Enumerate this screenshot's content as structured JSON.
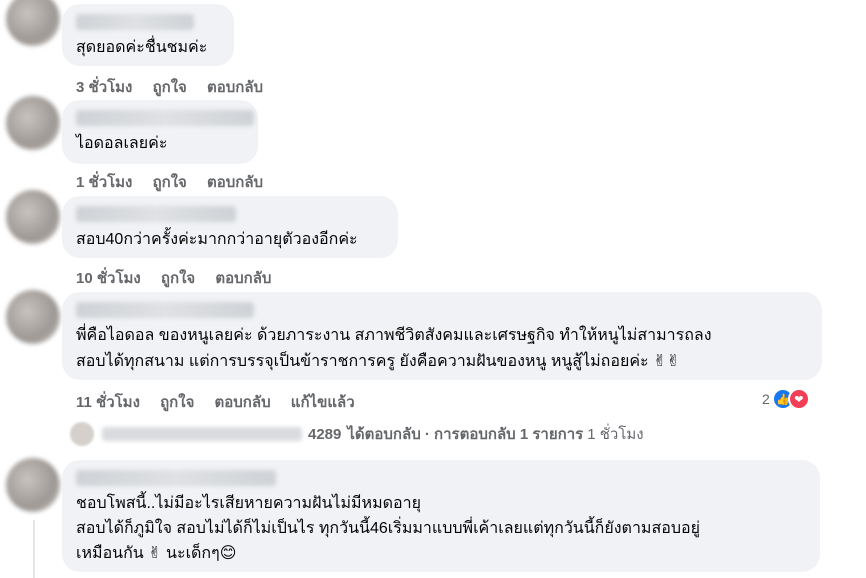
{
  "comments": [
    {
      "text_lines": [
        "สุดยอดค่ะชื่นชมค่ะ"
      ],
      "time": "3 ชั่วโมง",
      "like": "ถูกใจ",
      "reply": "ตอบกลับ"
    },
    {
      "text_lines": [
        "ไอดอลเลยค่ะ"
      ],
      "time": "1 ชั่วโมง",
      "like": "ถูกใจ",
      "reply": "ตอบกลับ"
    },
    {
      "text_lines": [
        "สอบ40กว่าครั้งค่ะมากกว่าอายุตัวองอีกค่ะ"
      ],
      "time": "10 ชั่วโมง",
      "like": "ถูกใจ",
      "reply": "ตอบกลับ"
    },
    {
      "text_lines": [
        "พี่คือไอดอล ของหนูเลยค่ะ ด้วยภาระงาน สภาพชีวิตสังคมและเศรษฐกิจ ทำให้หนูไม่สามารถลง",
        "สอบได้ทุกสนาม แต่การบรรจุเป็นข้าราชการครู ยังคือความฝันของหนู หนูสู้ไม่ถอยค่ะ ✌✌"
      ],
      "time": "11 ชั่วโมง",
      "like": "ถูกใจ",
      "reply": "ตอบกลับ",
      "edited": "แก้ไขแล้ว",
      "reaction_count": "2"
    },
    {
      "text_lines": [
        "ชอบโพสนี้..ไม่มีอะไรเสียหายความฝันไม่มีหมดอายุ",
        "สอบได้ก็ภูมิใจ สอบไม่ได้ก็ไม่เป็นไร ทุกวันนี้46เริ่มมาแบบพี่เค้าเลยแต่ทุกวันนี้ก็ยังตามสอบอยู่",
        "เหมือนกัน ✌ นะเด็กๆ😊"
      ]
    }
  ],
  "reply_summary": {
    "name_suffix": "4289",
    "text": "ได้ตอบกลับ · การตอบกลับ 1 รายการ",
    "time": "1 ชั่วโมง"
  },
  "colors": {
    "bubble": "#f0f2f5",
    "meta_text": "#65676b",
    "like_blue": "#1877f2",
    "love_red": "#f33e58"
  }
}
